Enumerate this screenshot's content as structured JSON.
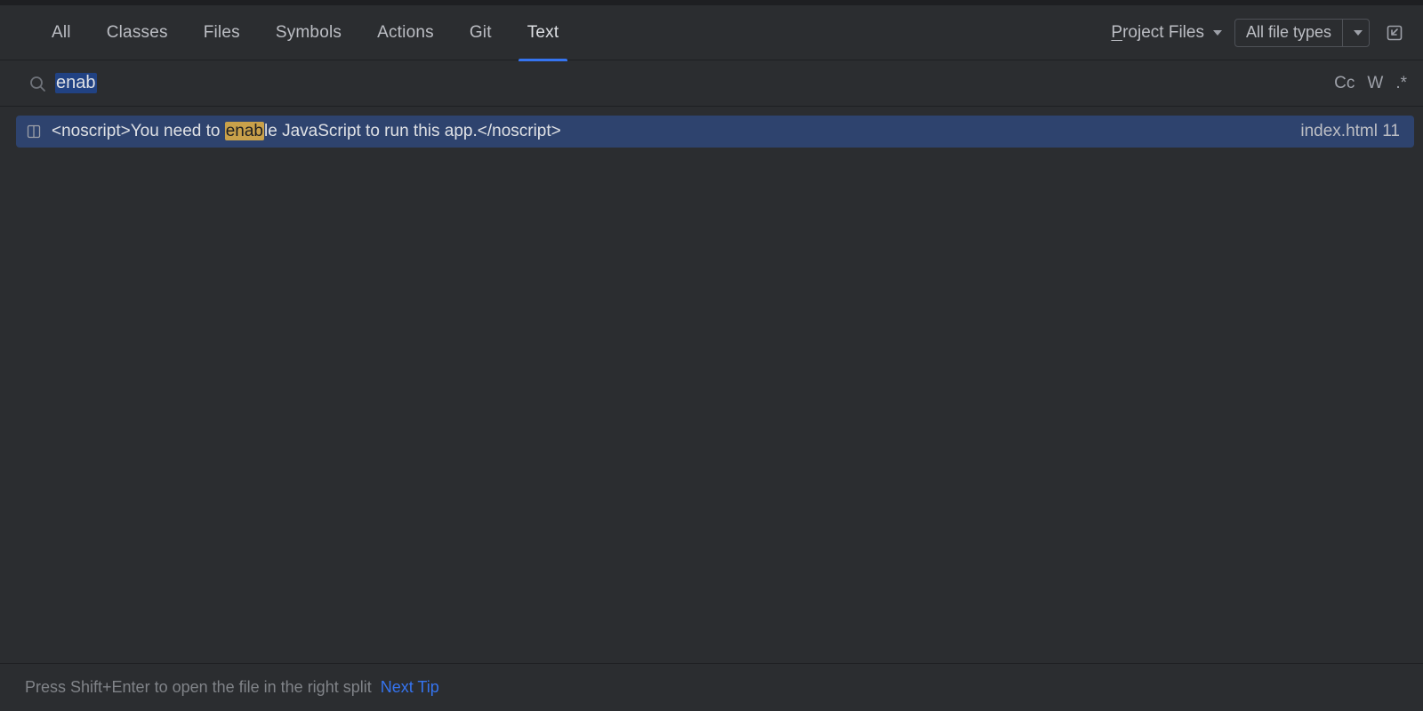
{
  "tabs": {
    "items": [
      "All",
      "Classes",
      "Files",
      "Symbols",
      "Actions",
      "Git",
      "Text"
    ],
    "active": "Text"
  },
  "scope": {
    "prefix": "P",
    "rest": "roject Files"
  },
  "filetypes": {
    "label": "All file types"
  },
  "search": {
    "query": "enab",
    "options": {
      "case": "Cc",
      "words": "W",
      "regex": ".*"
    }
  },
  "results": [
    {
      "pre": "<noscript>You need to ",
      "match": "enab",
      "post": "le JavaScript to run this app.</noscript>",
      "file": "index.html",
      "line": "11"
    }
  ],
  "hint": {
    "text": "Press Shift+Enter to open the file in the right split",
    "link": "Next Tip"
  }
}
